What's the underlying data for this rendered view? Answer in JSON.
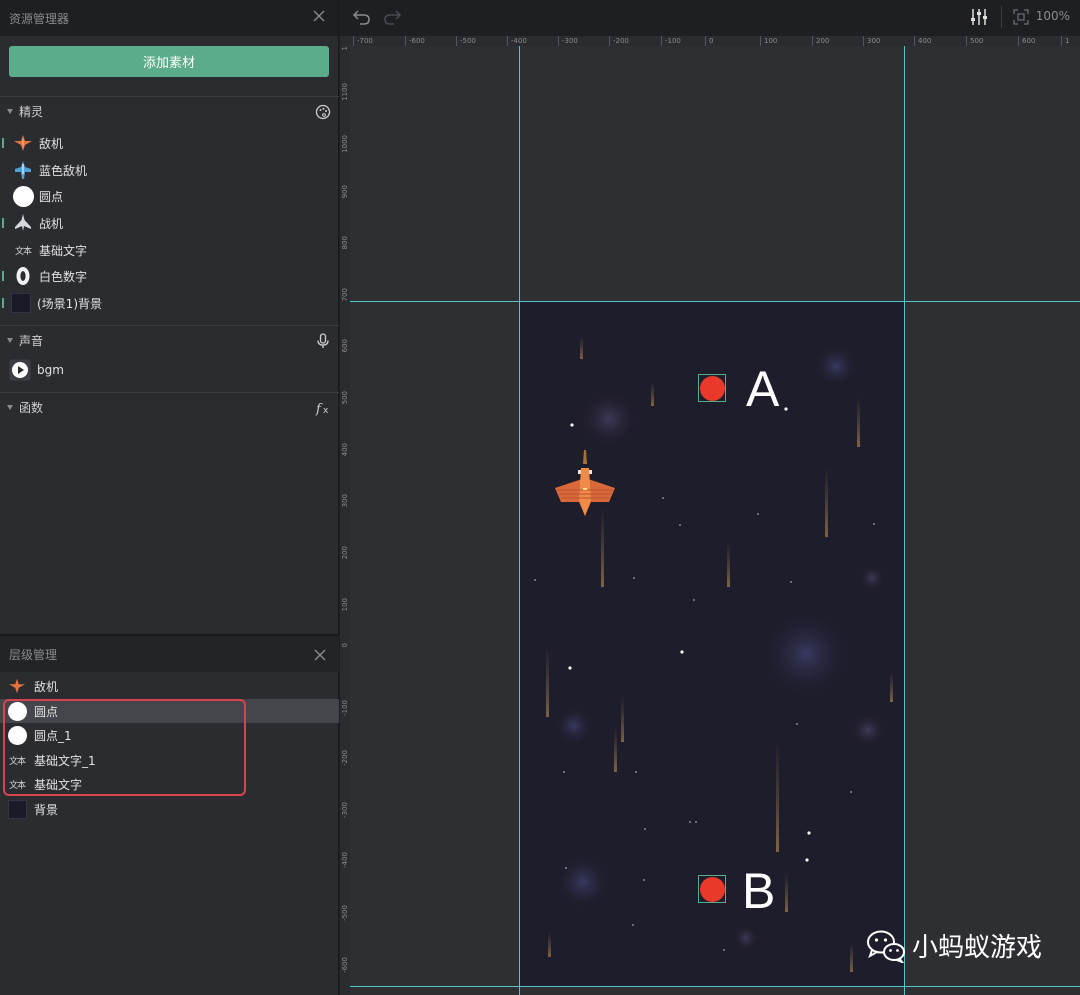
{
  "assets_panel": {
    "title": "资源管理器",
    "add_button": "添加素材",
    "sprites_section": "精灵",
    "sprites": [
      "敌机",
      "蓝色敌机",
      "圆点",
      "战机",
      "基础文字",
      "白色数字",
      "(场景1)背景"
    ],
    "sound_section": "声音",
    "sounds": [
      "bgm"
    ],
    "function_section": "函数"
  },
  "layers_panel": {
    "title": "层级管理",
    "items": [
      "敌机",
      "圆点",
      "圆点_1",
      "基础文字_1",
      "基础文字",
      "背景"
    ]
  },
  "toolbar": {
    "zoom": "100%"
  },
  "ruler": {
    "top_labels": [
      "-700",
      "-600",
      "-500",
      "-400",
      "-300",
      "-200",
      "-100",
      "0",
      "100",
      "200",
      "300",
      "400",
      "500",
      "600",
      "1"
    ],
    "left_labels": [
      "1",
      "1100",
      "1000",
      "900",
      "800",
      "700",
      "600",
      "500",
      "400",
      "300",
      "200",
      "100",
      "0",
      "-100",
      "-200",
      "-300",
      "-400",
      "-500",
      "-600"
    ]
  },
  "scene": {
    "label_a": "A",
    "label_b": "B"
  },
  "watermark": "小蚂蚁游戏",
  "colors": {
    "accent": "#5aac8a",
    "guide": "#56c3cc",
    "dot": "#e8392a",
    "highlight": "#d9434f"
  }
}
